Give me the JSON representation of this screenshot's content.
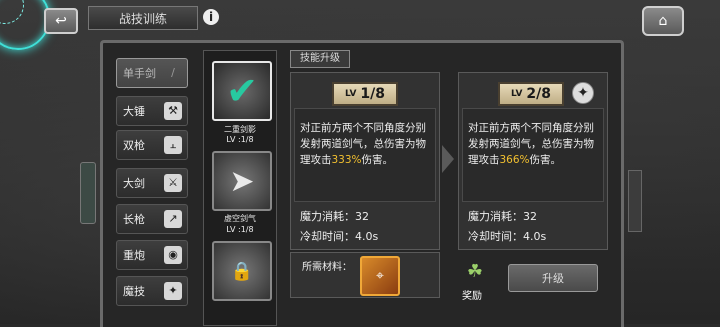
{
  "header": {
    "title": "战技训练",
    "back_icon": "back-arrow-icon",
    "info_icon": "info-icon",
    "home_icon": "home-icon"
  },
  "weapons": [
    {
      "label": "单手剑",
      "icon": "sword-icon",
      "active": true
    },
    {
      "label": "大锤",
      "icon": "hammer-icon",
      "active": false
    },
    {
      "label": "双枪",
      "icon": "dual-pistol-icon",
      "active": false
    },
    {
      "label": "大剑",
      "icon": "greatsword-icon",
      "active": false
    },
    {
      "label": "长枪",
      "icon": "spear-icon",
      "active": false
    },
    {
      "label": "重炮",
      "icon": "cannon-icon",
      "active": false
    },
    {
      "label": "魔技",
      "icon": "magic-icon",
      "active": false
    }
  ],
  "skills": [
    {
      "name": "二重剑影",
      "level": "LV :1/8",
      "state": "selected"
    },
    {
      "name": "虚空剑气",
      "level": "LV :1/8",
      "state": "normal"
    },
    {
      "name": "",
      "level": "",
      "state": "locked"
    }
  ],
  "upgrade_tag": "技能升级",
  "current": {
    "lv_prefix": "LV",
    "level": "1/8",
    "desc_pre": "对正前方两个不同角度分别发射两道剑气，总伤害为物理攻击",
    "pct": "333%",
    "desc_post": "伤害。",
    "mana": "魔力消耗：32",
    "cooldown": "冷却时间：4.0s"
  },
  "next": {
    "lv_prefix": "LV",
    "level": "2/8",
    "desc_pre": "对正前方两个不同角度分别发射两道剑气，总伤害为物理攻击",
    "pct": "366%",
    "desc_post": "伤害。",
    "mana": "魔力消耗：32",
    "cooldown": "冷却时间：4.0s"
  },
  "materials_label": "所需材料：",
  "reward_label": "奖励",
  "upgrade_button": "升级",
  "colors": {
    "accent_teal": "#3fe0d8",
    "highlight_gold": "#f2c030",
    "check_green": "#27c9a0"
  }
}
